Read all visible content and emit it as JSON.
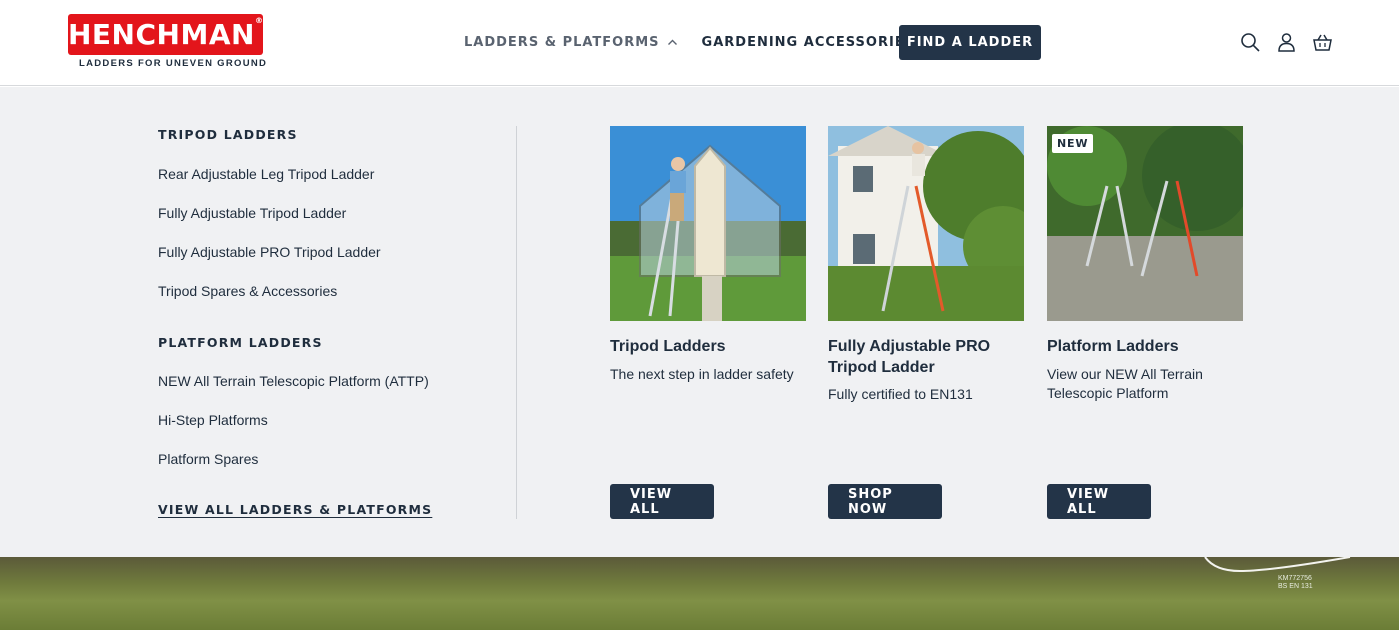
{
  "brand": {
    "name": "HENCHMAN",
    "registered": "®",
    "tagline": "LADDERS FOR UNEVEN GROUND",
    "color": "#e3151b"
  },
  "nav": {
    "items": [
      {
        "label": "LADDERS & PLATFORMS",
        "icon": "chevron-up-icon",
        "active": true
      },
      {
        "label": "GARDENING ACCESSORIES",
        "icon": "chevron-down-icon",
        "active": false
      }
    ],
    "cta_label": "FIND A LADDER"
  },
  "header_icons": [
    "search-icon",
    "account-icon",
    "basket-icon"
  ],
  "mega_menu": {
    "sections": [
      {
        "title": "TRIPOD LADDERS",
        "links": [
          "Rear Adjustable Leg Tripod Ladder",
          "Fully Adjustable Tripod Ladder",
          "Fully Adjustable PRO Tripod Ladder",
          "Tripod Spares & Accessories"
        ]
      },
      {
        "title": "PLATFORM LADDERS",
        "links": [
          "NEW All Terrain Telescopic Platform (ATTP)",
          "Hi-Step Platforms",
          "Platform Spares"
        ]
      }
    ],
    "view_all_label": "VIEW ALL LADDERS & PLATFORMS",
    "cards": [
      {
        "title": "Tripod Ladders",
        "description": "The next step in ladder safety",
        "button": "VIEW ALL",
        "badge": ""
      },
      {
        "title": "Fully Adjustable PRO Tripod Ladder",
        "description": "Fully certified to EN131",
        "button": "SHOP NOW",
        "badge": ""
      },
      {
        "title": "Platform Ladders",
        "description": "View our NEW All Terrain Telescopic Platform",
        "button": "VIEW ALL",
        "badge": "NEW"
      }
    ]
  },
  "hero": {
    "cert_lines": [
      "KM772756",
      "BS EN 131"
    ]
  },
  "colors": {
    "navy": "#233448",
    "menu_bg": "#f0f1f3",
    "text": "#1f2d3d"
  }
}
